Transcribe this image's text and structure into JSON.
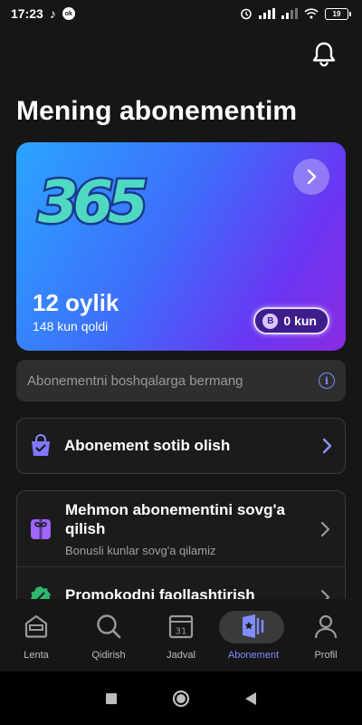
{
  "status_bar": {
    "time": "17:23",
    "battery": "19"
  },
  "header": {
    "title": "Mening abonementim"
  },
  "subscription_card": {
    "logo_text": "365",
    "period": "12 oylik",
    "days_left": "148 kun qoldi",
    "bonus_letter": "B",
    "bonus_value": "0 kun",
    "colors": {
      "gradient_start": "#2aa5ff",
      "gradient_end": "#8a2be2"
    }
  },
  "notice": {
    "text": "Abonementni boshqalarga bermang"
  },
  "actions": {
    "buy": {
      "label": "Abonement sotib olish"
    },
    "gift": {
      "title": "Mehmon abonementini sovg'a qilish",
      "subtitle": "Bonusli kunlar sovg'a qilamiz"
    },
    "promo": {
      "label": "Promokodni faollashtirish"
    }
  },
  "bottom_nav": {
    "items": [
      {
        "label": "Lenta",
        "icon": "home-icon"
      },
      {
        "label": "Qidirish",
        "icon": "search-icon"
      },
      {
        "label": "Jadval",
        "icon": "calendar-icon",
        "calendar_day": "31"
      },
      {
        "label": "Abonement",
        "icon": "subscription-icon",
        "active": true
      },
      {
        "label": "Profil",
        "icon": "profile-icon"
      }
    ]
  },
  "accent_color": "#7f8cff"
}
